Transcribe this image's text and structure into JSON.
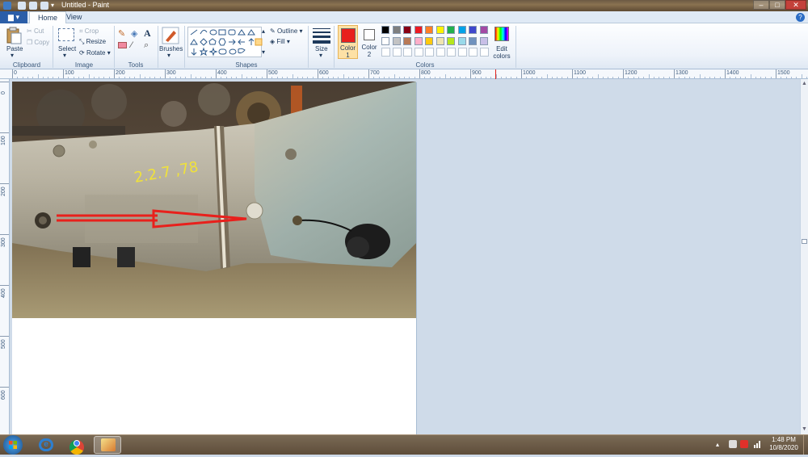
{
  "window": {
    "title": "Untitled - Paint"
  },
  "tabs": [
    {
      "label": "Home",
      "active": true
    },
    {
      "label": "View",
      "active": false
    }
  ],
  "ribbon": {
    "clipboard": {
      "label": "Clipboard",
      "paste": "Paste",
      "cut": "Cut",
      "copy": "Copy"
    },
    "image": {
      "label": "Image",
      "select": "Select",
      "crop": "Crop",
      "resize": "Resize",
      "rotate": "Rotate"
    },
    "tools": {
      "label": "Tools"
    },
    "brushes": {
      "label": "Brushes"
    },
    "shapes": {
      "label": "Shapes",
      "outline": "Outline",
      "fill": "Fill"
    },
    "size": {
      "label": "Size"
    },
    "colors": {
      "label": "Colors",
      "color1": "Color\n1",
      "color1_line1": "Color",
      "color1_line2": "1",
      "color2_line1": "Color",
      "color2_line2": "2",
      "edit_line1": "Edit",
      "edit_line2": "colors",
      "color1_value": "#e8201c",
      "color2_value": "#ffffff",
      "palette_row1": [
        "#000000",
        "#7f7f7f",
        "#880015",
        "#ed1c24",
        "#ff7f27",
        "#fff200",
        "#22b14c",
        "#00a2e8",
        "#3f48cc",
        "#a349a4"
      ],
      "palette_row2": [
        "#ffffff",
        "#c3c3c3",
        "#b97a57",
        "#ffaec9",
        "#ffc90e",
        "#efe4b0",
        "#b5e61d",
        "#99d9ea",
        "#7092be",
        "#c8bfe7"
      ]
    }
  },
  "ruler": {
    "h_labels": [
      "0",
      "100",
      "200",
      "300",
      "400",
      "500",
      "600",
      "700",
      "800",
      "900",
      "1000",
      "1100",
      "1200",
      "1300",
      "1400",
      "1500"
    ],
    "v_labels": [
      "0",
      "100",
      "200",
      "300",
      "400",
      "500",
      "600"
    ]
  },
  "taskbar": {
    "time": "1:48 PM",
    "date": "10/8/2020"
  }
}
